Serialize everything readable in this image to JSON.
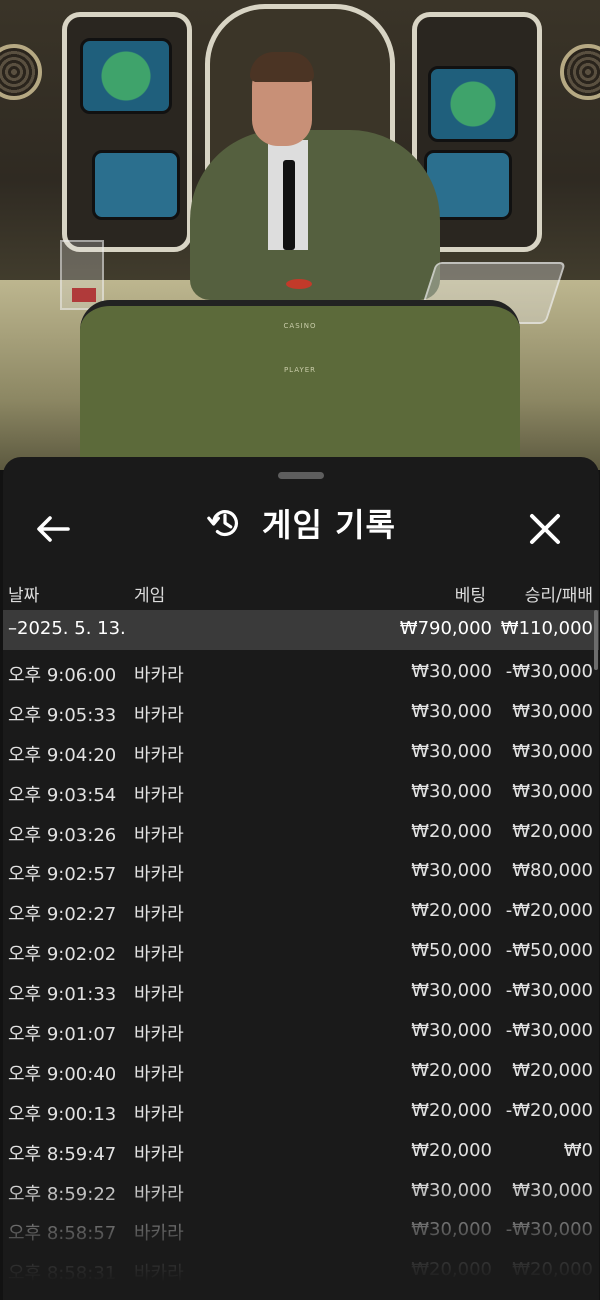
{
  "header": {
    "title": "게임 기록",
    "back_icon": "arrow-left-icon",
    "history_icon": "history-icon",
    "close_icon": "close-icon"
  },
  "video": {
    "felt_label_top": "CASINO",
    "felt_label_player": "PLAYER"
  },
  "columns": {
    "date": "날짜",
    "game": "게임",
    "bet": "베팅",
    "win_loss": "승리/패배"
  },
  "date_group": {
    "date": "–2025. 5. 13.",
    "bet_total": "₩790,000",
    "win_total": "₩110,000"
  },
  "rows": [
    {
      "time": "오후 9:06:00",
      "game": "바카라",
      "bet": "₩30,000",
      "result": "-₩30,000"
    },
    {
      "time": "오후 9:05:33",
      "game": "바카라",
      "bet": "₩30,000",
      "result": "₩30,000"
    },
    {
      "time": "오후 9:04:20",
      "game": "바카라",
      "bet": "₩30,000",
      "result": "₩30,000"
    },
    {
      "time": "오후 9:03:54",
      "game": "바카라",
      "bet": "₩30,000",
      "result": "₩30,000"
    },
    {
      "time": "오후 9:03:26",
      "game": "바카라",
      "bet": "₩20,000",
      "result": "₩20,000"
    },
    {
      "time": "오후 9:02:57",
      "game": "바카라",
      "bet": "₩30,000",
      "result": "₩80,000"
    },
    {
      "time": "오후 9:02:27",
      "game": "바카라",
      "bet": "₩20,000",
      "result": "-₩20,000"
    },
    {
      "time": "오후 9:02:02",
      "game": "바카라",
      "bet": "₩50,000",
      "result": "-₩50,000"
    },
    {
      "time": "오후 9:01:33",
      "game": "바카라",
      "bet": "₩30,000",
      "result": "-₩30,000"
    },
    {
      "time": "오후 9:01:07",
      "game": "바카라",
      "bet": "₩30,000",
      "result": "-₩30,000"
    },
    {
      "time": "오후 9:00:40",
      "game": "바카라",
      "bet": "₩20,000",
      "result": "₩20,000"
    },
    {
      "time": "오후 9:00:13",
      "game": "바카라",
      "bet": "₩20,000",
      "result": "-₩20,000"
    },
    {
      "time": "오후 8:59:47",
      "game": "바카라",
      "bet": "₩20,000",
      "result": "₩0"
    },
    {
      "time": "오후 8:59:22",
      "game": "바카라",
      "bet": "₩30,000",
      "result": "₩30,000"
    },
    {
      "time": "오후 8:58:57",
      "game": "바카라",
      "bet": "₩30,000",
      "result": "-₩30,000"
    },
    {
      "time": "오후 8:58:31",
      "game": "바카라",
      "bet": "₩20,000",
      "result": "₩20,000"
    }
  ]
}
